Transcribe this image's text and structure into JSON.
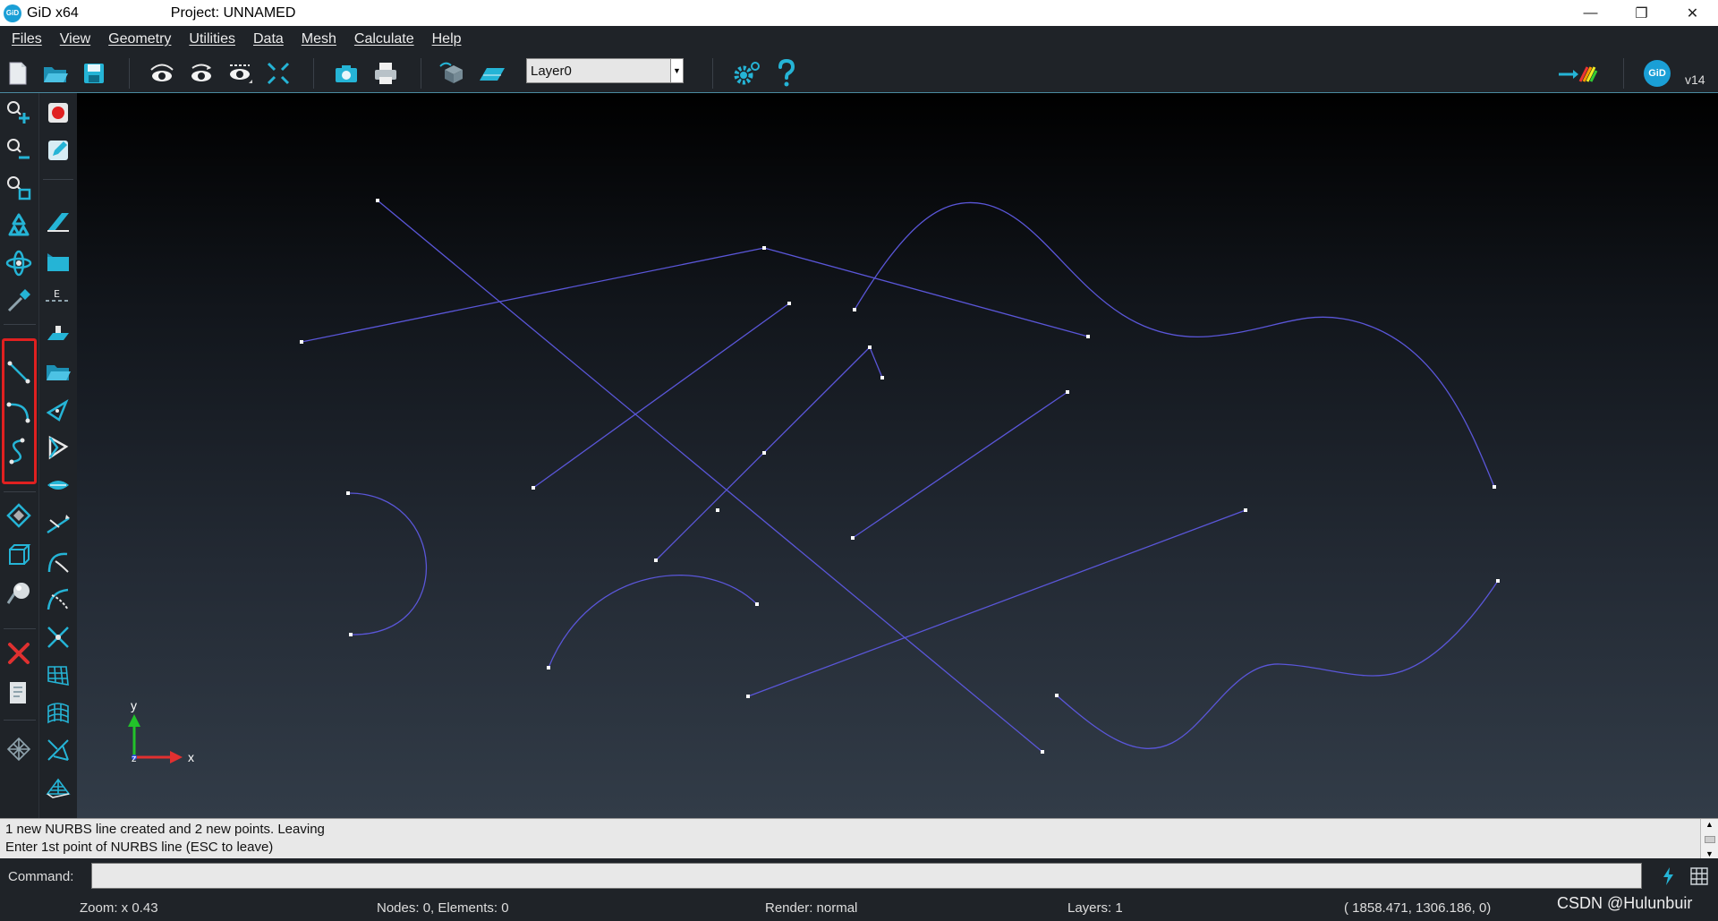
{
  "titlebar": {
    "logo_text": "GiD",
    "app_name": "GiD x64",
    "project": "Project: UNNAMED",
    "controls": {
      "minimize": "—",
      "restore": "❐",
      "close": "✕"
    }
  },
  "menu": {
    "items": [
      "Files",
      "View",
      "Geometry",
      "Utilities",
      "Data",
      "Mesh",
      "Calculate",
      "Help"
    ]
  },
  "toolbar": {
    "layer_value": "Layer0",
    "version": "v14",
    "logo_text": "GiD"
  },
  "message": {
    "line1": "1 new NURBS line created and 2 new points. Leaving",
    "line2": "Enter 1st point of NURBS line (ESC to leave)"
  },
  "command": {
    "label": "Command:",
    "value": ""
  },
  "status": {
    "zoom": "Zoom: x 0.43",
    "nodes": "Nodes: 0, Elements: 0",
    "render": "Render: normal",
    "layers": "Layers: 1",
    "coords": "(  1858.471,   1306.186,  0)"
  },
  "axes": {
    "x": "x",
    "y": "y",
    "z": "z"
  },
  "watermark": "CSDN @Hulunbuir",
  "colors": {
    "chrome": "#1f2328",
    "geometry_line": "#5a56d8",
    "point": "#ffffff",
    "highlight": "#e02020",
    "icon_cyan": "#25b4d6"
  },
  "icons": {
    "top": [
      "new-file-icon",
      "open-folder-icon",
      "save-icon",
      "view-rotate-icon",
      "view-rotate-alt-icon",
      "view-options-icon",
      "zoom-frame-icon",
      "camera-icon",
      "print-icon",
      "layers-cube-icon",
      "layer-plane-icon",
      "settings-gear-icon",
      "help-question-icon",
      "arrow-rainbow-icon",
      "gid-logo-icon"
    ],
    "left_col1": [
      "zoom-in-icon",
      "zoom-out-icon",
      "zoom-window-icon",
      "redraw-icon",
      "rotate-center-icon",
      "pick-icon",
      "create-straight-line-icon",
      "create-arc-icon",
      "create-nurbs-line-icon",
      "create-surface-icon",
      "create-volume-icon",
      "render-sphere-icon",
      "delete-icon",
      "list-info-icon",
      "mesh-icon"
    ],
    "left_col2": [
      "record-icon",
      "edit-icon",
      "eraser-icon",
      "folder-icon",
      "edit-e-icon",
      "layer-load-icon",
      "folder-open-icon",
      "geometry-tool-a-icon",
      "geometry-tool-b-icon",
      "surface-tool-icon",
      "line-tool-a-icon",
      "curve-tool-a-icon",
      "curve-tool-b-icon",
      "intersect-icon",
      "grid-surface-a-icon",
      "grid-surface-b-icon",
      "mesh-tool-a-icon",
      "mesh-tool-b-icon"
    ]
  }
}
